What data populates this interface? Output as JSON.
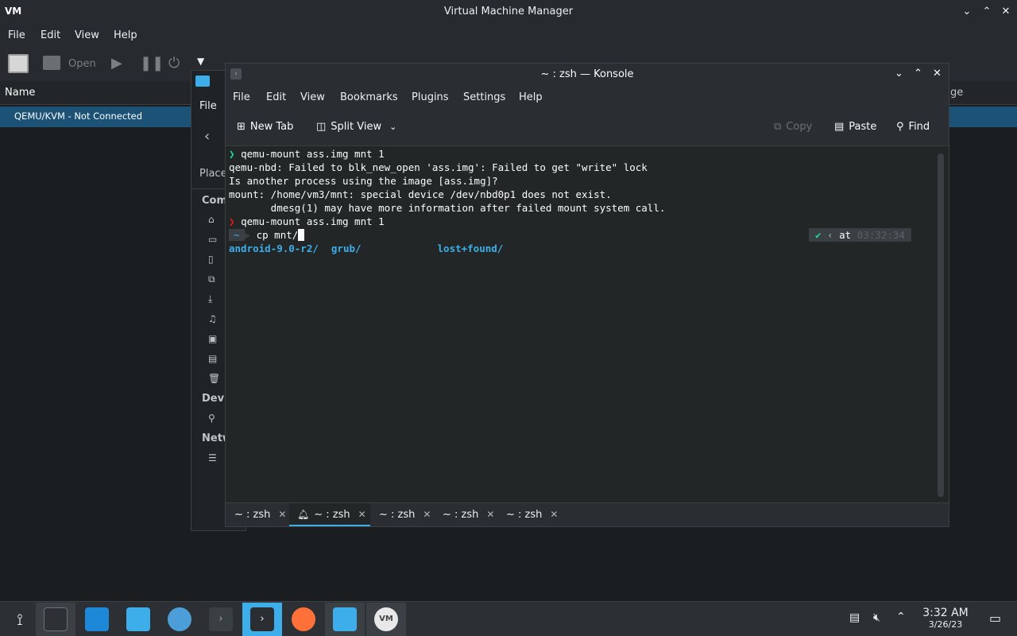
{
  "vmm": {
    "title": "Virtual Machine Manager",
    "menu": [
      "File",
      "Edit",
      "View",
      "Help"
    ],
    "toolbar": {
      "open_label": "Open"
    },
    "header": {
      "name_col": "Name",
      "right_col": "ge"
    },
    "connection_row": "QEMU/KVM - Not Connected"
  },
  "filemanager": {
    "menu_file": "File",
    "places_label": "Place",
    "sections": {
      "computer": "Com",
      "devices": "Devi",
      "network": "Netw"
    }
  },
  "konsole": {
    "title": "~ : zsh — Konsole",
    "menu": [
      "File",
      "Edit",
      "View",
      "Bookmarks",
      "Plugins",
      "Settings",
      "Help"
    ],
    "toolbar": {
      "new_tab": "New Tab",
      "split_view": "Split View",
      "copy": "Copy",
      "paste": "Paste",
      "find": "Find"
    },
    "terminal": {
      "lines": [
        "qemu-mount ass.img mnt 1",
        "qemu-nbd: Failed to blk_new_open 'ass.img': Failed to get \"write\" lock",
        "Is another process using the image [ass.img]?",
        "mount: /home/vm3/mnt: special device /dev/nbd0p1 does not exist.",
        "       dmesg(1) may have more information after failed mount system call.",
        "qemu-mount ass.img mnt 1"
      ],
      "prompt_dir": "~",
      "current_command": "cp mnt/",
      "right_prompt_at": "at",
      "right_prompt_time": "03:32:34",
      "completions": [
        "android-9.0-r2/",
        "grub/",
        "lost+found/"
      ]
    },
    "tabs": [
      "~ : zsh",
      "~ : zsh",
      "~ : zsh",
      "~ : zsh",
      "~ : zsh"
    ]
  },
  "taskbar": {
    "clock_time": "3:32 AM",
    "clock_date": "3/26/23"
  },
  "colors": {
    "accent": "#3daee9",
    "selection": "#1d5277",
    "error": "#ed1515",
    "prompt_ok": "#1cdc9a",
    "path": "#3daee9"
  }
}
